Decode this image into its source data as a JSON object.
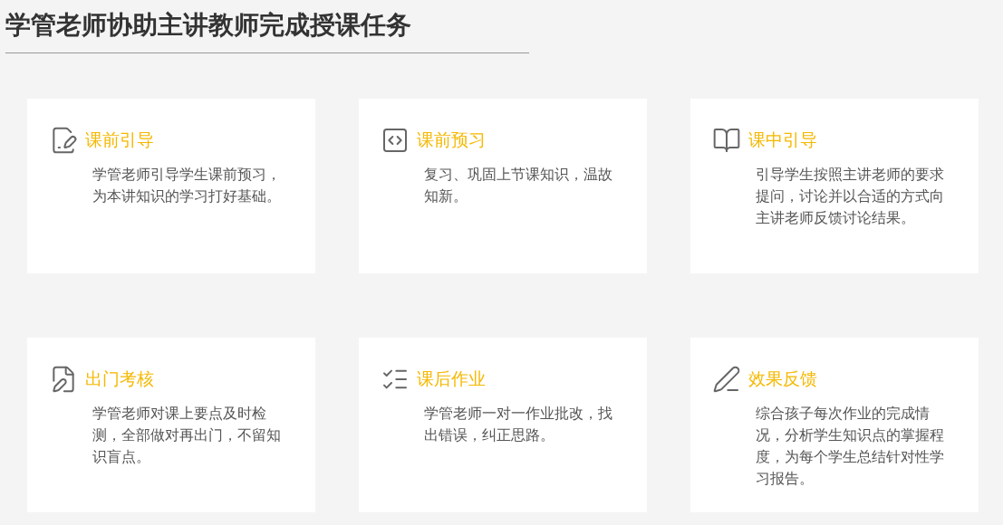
{
  "title": "学管老师协助主讲教师完成授课任务",
  "cards": [
    {
      "title": "课前引导",
      "description": "学管老师引导学生课前预习，为本讲知识的学习打好基础。"
    },
    {
      "title": "课前预习",
      "description": "复习、巩固上节课知识，温故知新。"
    },
    {
      "title": "课中引导",
      "description": "引导学生按照主讲老师的要求提问，讨论并以合适的方式向主讲老师反馈讨论结果。"
    },
    {
      "title": "出门考核",
      "description": "学管老师对课上要点及时检测，全部做对再出门，不留知识盲点。"
    },
    {
      "title": "课后作业",
      "description": "学管老师一对一作业批改，找出错误，纠正思路。"
    },
    {
      "title": "效果反馈",
      "description": "综合孩子每次作业的完成情况，分析学生知识点的掌握程度，为每个学生总结针对性学习报告。"
    }
  ]
}
